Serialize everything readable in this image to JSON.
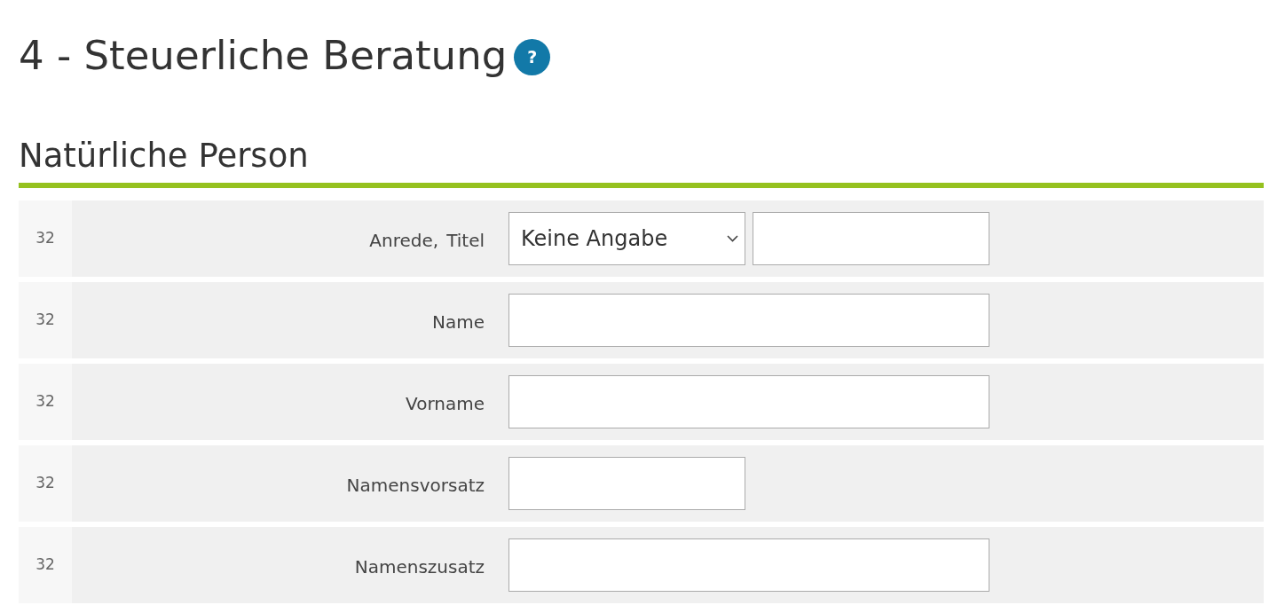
{
  "page": {
    "title": "4 - Steuerliche Beratung",
    "help_icon": "?"
  },
  "section": {
    "heading": "Natürliche Person"
  },
  "rows": [
    {
      "number": "32",
      "labels": [
        "Anrede,",
        "Titel"
      ],
      "fields": [
        {
          "kind": "select",
          "value": "Keine Angabe"
        },
        {
          "kind": "input_narrow"
        }
      ]
    },
    {
      "number": "32",
      "labels": [
        "Name"
      ],
      "fields": [
        {
          "kind": "input_wide"
        }
      ]
    },
    {
      "number": "32",
      "labels": [
        "Vorname"
      ],
      "fields": [
        {
          "kind": "input_wide"
        }
      ]
    },
    {
      "number": "32",
      "labels": [
        "Namensvorsatz"
      ],
      "fields": [
        {
          "kind": "input_narrow"
        }
      ]
    },
    {
      "number": "32",
      "labels": [
        "Namenszusatz"
      ],
      "fields": [
        {
          "kind": "input_wide"
        }
      ]
    }
  ]
}
